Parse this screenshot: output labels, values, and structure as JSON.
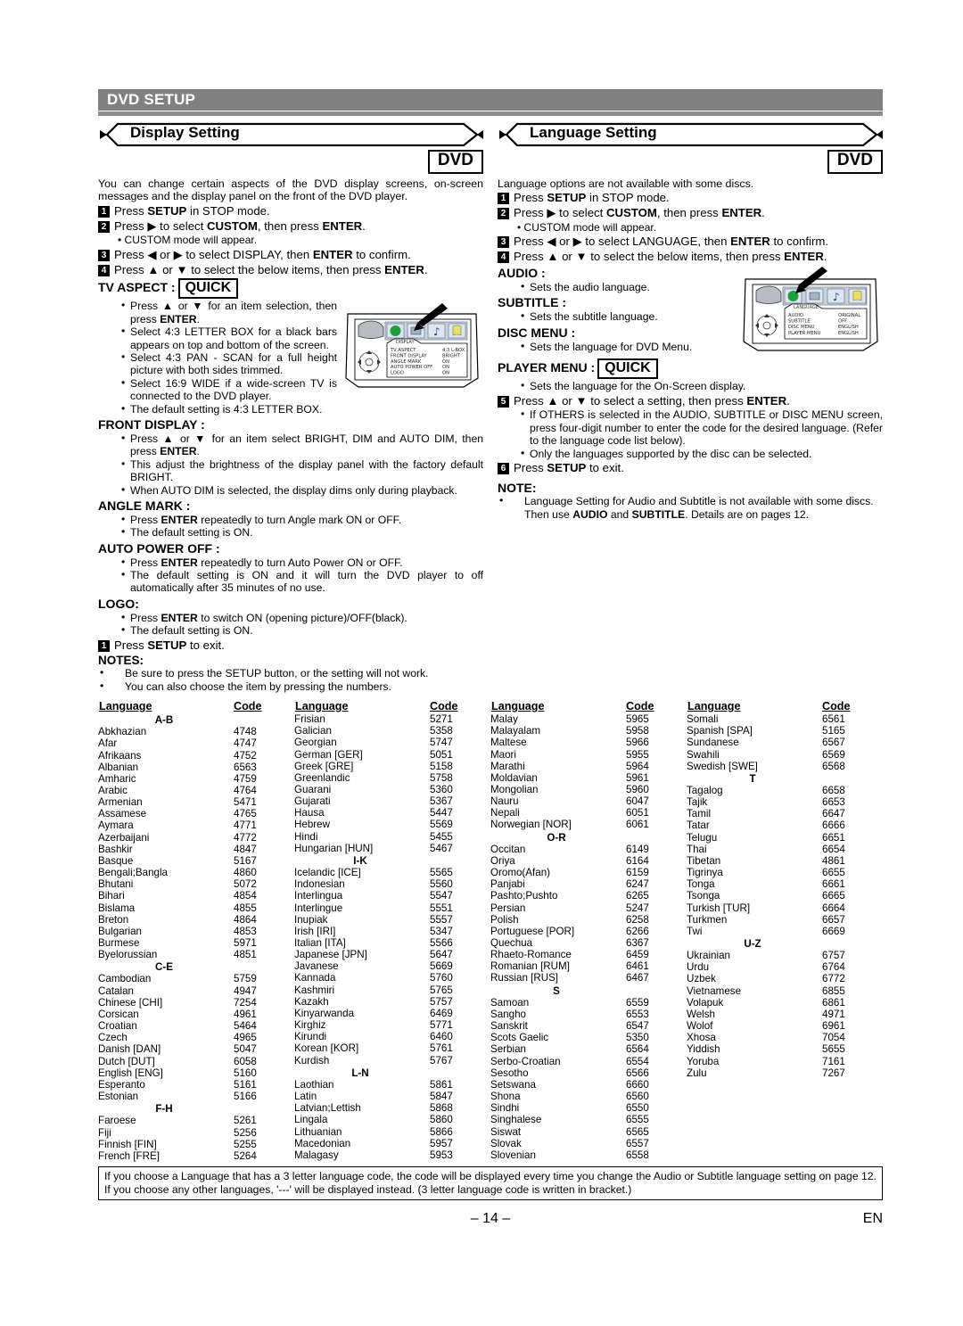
{
  "header": {
    "title": "DVD SETUP"
  },
  "left": {
    "ribbon_title": "Display Setting",
    "disc_badge": "DVD",
    "intro": "You can change certain aspects of the DVD display screens, on-screen messages and the display panel on the front of the DVD player.",
    "steps": [
      {
        "n": "1",
        "text_html": "Press <b>SETUP</b> in STOP mode."
      },
      {
        "n": "2",
        "text_html": "Press ▶ to select <b>CUSTOM</b>, then press <b>ENTER</b>."
      },
      {
        "n": "3",
        "text_html": "Press ◀ or ▶ to select DISPLAY, then <b>ENTER</b> to confirm."
      },
      {
        "n": "4",
        "text_html": "Press ▲ or ▼ to select the below items, then press <b>ENTER</b>."
      }
    ],
    "step2_sub": "CUSTOM mode will appear.",
    "tv_aspect": {
      "label": "TV ASPECT :",
      "quick": "QUICK",
      "bullets_html": [
        "Press ▲ or ▼ for an item selection, then press <b>ENTER</b>.",
        "Select 4:3 LETTER BOX for a black bars appears on top and bottom of the screen.",
        "Select 4:3 PAN - SCAN for a full height picture with both sides trimmed.",
        "Select 16:9 WIDE if a wide-screen TV is connected to the DVD player.",
        "The default setting is 4:3 LETTER BOX."
      ]
    },
    "front_display": {
      "label": "FRONT DISPLAY :",
      "bullets_html": [
        "Press ▲ or ▼ for an item select BRIGHT, DIM and AUTO DIM, then press <b>ENTER</b>.",
        "This adjust the brightness of the display panel with the factory default BRIGHT.",
        "When AUTO DIM is selected, the display dims only during playback."
      ]
    },
    "angle_mark": {
      "label": "ANGLE MARK :",
      "bullets_html": [
        "Press <b>ENTER</b> repeatedly to turn Angle mark ON or OFF.",
        "The default setting is ON."
      ]
    },
    "auto_power_off": {
      "label": "AUTO POWER OFF :",
      "bullets_html": [
        "Press <b>ENTER</b> repeatedly to turn Auto Power ON or OFF.",
        "The default setting is ON and it will turn the DVD player to off automatically after 35 minutes of no use."
      ]
    },
    "logo": {
      "label": "LOGO:",
      "bullets_html": [
        "Press <b>ENTER</b> to switch ON (opening picture)/OFF(black).",
        "The default setting is ON."
      ]
    },
    "exit_step": {
      "n": "1",
      "text_html": "Press <b>SETUP</b> to exit."
    },
    "notes_label": "NOTES:",
    "notes": [
      "Be sure to press the SETUP button, or the setting will not work.",
      "You can also choose the item by pressing the numbers."
    ],
    "osd": {
      "title": "DISPLAY",
      "rows": [
        {
          "name": "TV ASPECT",
          "value": "4:3 L-BOX"
        },
        {
          "name": "FRONT DISPLAY",
          "value": "BRIGHT"
        },
        {
          "name": "ANGLE MARK",
          "value": "ON"
        },
        {
          "name": "AUTO POWER OFF",
          "value": "ON"
        },
        {
          "name": "LOGO",
          "value": "ON"
        }
      ]
    }
  },
  "right": {
    "ribbon_title": "Language Setting",
    "disc_badge": "DVD",
    "intro": "Language options are not available with some discs.",
    "steps": [
      {
        "n": "1",
        "text_html": "Press <b>SETUP</b> in STOP mode."
      },
      {
        "n": "2",
        "text_html": "Press ▶ to select <b>CUSTOM</b>, then press <b>ENTER</b>."
      },
      {
        "n": "3",
        "text_html": "Press ◀ or ▶ to select LANGUAGE, then <b>ENTER</b> to confirm."
      },
      {
        "n": "4",
        "text_html": "Press ▲ or ▼ to select the below items, then press <b>ENTER</b>."
      }
    ],
    "step2_sub": "CUSTOM mode will appear.",
    "audio": {
      "label": "AUDIO :",
      "bullet": "Sets the audio language."
    },
    "subtitle": {
      "label": "SUBTITLE :",
      "bullet": "Sets the subtitle language."
    },
    "disc_menu": {
      "label": "DISC MENU :",
      "bullet": "Sets the language for DVD Menu."
    },
    "player_menu": {
      "label": "PLAYER MENU :",
      "quick": "QUICK",
      "bullet": "Sets the language for the On-Screen display."
    },
    "step5": {
      "n": "5",
      "text_html": "Press ▲ or ▼ to select a setting, then press <b>ENTER</b>."
    },
    "step5_bullets": [
      "If OTHERS is selected in the AUDIO, SUBTITLE or DISC MENU screen, press four-digit number to enter the code for the desired language. (Refer to the language code list below).",
      "Only the languages supported by the disc can be selected."
    ],
    "step6": {
      "n": "6",
      "text_html": "Press <b>SETUP</b> to exit."
    },
    "note_label": "NOTE:",
    "note_html": "Language Setting for Audio and Subtitle is not available with some discs. Then use <b>AUDIO</b> and <b>SUBTITLE</b>. Details are on pages 12.",
    "osd": {
      "title": "LANGUAGE",
      "rows": [
        {
          "name": "AUDIO",
          "value": "ORIGINAL"
        },
        {
          "name": "SUBTITLE",
          "value": "OFF"
        },
        {
          "name": "DISC MENU",
          "value": "ENGLISH"
        },
        {
          "name": "PLAYER MENU",
          "value": "ENGLISH"
        }
      ]
    }
  },
  "table": {
    "head_language": "Language",
    "head_code": "Code",
    "columns": [
      [
        {
          "group": "A-B"
        },
        {
          "lang": "Abkhazian",
          "code": "4748"
        },
        {
          "lang": "Afar",
          "code": "4747"
        },
        {
          "lang": "Afrikaans",
          "code": "4752"
        },
        {
          "lang": "Albanian",
          "code": "6563"
        },
        {
          "lang": "Amharic",
          "code": "4759"
        },
        {
          "lang": "Arabic",
          "code": "4764"
        },
        {
          "lang": "Armenian",
          "code": "5471"
        },
        {
          "lang": "Assamese",
          "code": "4765"
        },
        {
          "lang": "Aymara",
          "code": "4771"
        },
        {
          "lang": "Azerbaijani",
          "code": "4772"
        },
        {
          "lang": "Bashkir",
          "code": "4847"
        },
        {
          "lang": "Basque",
          "code": "5167"
        },
        {
          "lang": "Bengali;Bangla",
          "code": "4860"
        },
        {
          "lang": "Bhutani",
          "code": "5072"
        },
        {
          "lang": "Bihari",
          "code": "4854"
        },
        {
          "lang": "Bislama",
          "code": "4855"
        },
        {
          "lang": "Breton",
          "code": "4864"
        },
        {
          "lang": "Bulgarian",
          "code": "4853"
        },
        {
          "lang": "Burmese",
          "code": "5971"
        },
        {
          "lang": "Byelorussian",
          "code": "4851"
        },
        {
          "group": "C-E"
        },
        {
          "lang": "Cambodian",
          "code": "5759"
        },
        {
          "lang": "Catalan",
          "code": "4947"
        },
        {
          "lang": "Chinese [CHI]",
          "code": "7254"
        },
        {
          "lang": "Corsican",
          "code": "4961"
        },
        {
          "lang": "Croatian",
          "code": "5464"
        },
        {
          "lang": "Czech",
          "code": "4965"
        },
        {
          "lang": "Danish [DAN]",
          "code": "5047"
        },
        {
          "lang": "Dutch [DUT]",
          "code": "6058"
        },
        {
          "lang": "English [ENG]",
          "code": "5160"
        },
        {
          "lang": "Esperanto",
          "code": "5161"
        },
        {
          "lang": "Estonian",
          "code": "5166"
        },
        {
          "group": "F-H"
        },
        {
          "lang": "Faroese",
          "code": "5261"
        },
        {
          "lang": "Fiji",
          "code": "5256"
        },
        {
          "lang": "Finnish [FIN]",
          "code": "5255"
        },
        {
          "lang": "French [FRE]",
          "code": "5264"
        }
      ],
      [
        {
          "lang": "Frisian",
          "code": "5271"
        },
        {
          "lang": "Galician",
          "code": "5358"
        },
        {
          "lang": "Georgian",
          "code": "5747"
        },
        {
          "lang": "German [GER]",
          "code": "5051"
        },
        {
          "lang": "Greek [GRE]",
          "code": "5158"
        },
        {
          "lang": "Greenlandic",
          "code": "5758"
        },
        {
          "lang": "Guarani",
          "code": "5360"
        },
        {
          "lang": "Gujarati",
          "code": "5367"
        },
        {
          "lang": "Hausa",
          "code": "5447"
        },
        {
          "lang": "Hebrew",
          "code": "5569"
        },
        {
          "lang": "Hindi",
          "code": "5455"
        },
        {
          "lang": "Hungarian [HUN]",
          "code": "5467"
        },
        {
          "group": "I-K"
        },
        {
          "lang": "Icelandic [ICE]",
          "code": "5565"
        },
        {
          "lang": "Indonesian",
          "code": "5560"
        },
        {
          "lang": "Interlingua",
          "code": "5547"
        },
        {
          "lang": "Interlingue",
          "code": "5551"
        },
        {
          "lang": "Inupiak",
          "code": "5557"
        },
        {
          "lang": "Irish [IRI]",
          "code": "5347"
        },
        {
          "lang": "Italian [ITA]",
          "code": "5566"
        },
        {
          "lang": "Japanese [JPN]",
          "code": "5647"
        },
        {
          "lang": "Javanese",
          "code": "5669"
        },
        {
          "lang": "Kannada",
          "code": "5760"
        },
        {
          "lang": "Kashmiri",
          "code": "5765"
        },
        {
          "lang": "Kazakh",
          "code": "5757"
        },
        {
          "lang": "Kinyarwanda",
          "code": "6469"
        },
        {
          "lang": "Kirghiz",
          "code": "5771"
        },
        {
          "lang": "Kirundi",
          "code": "6460"
        },
        {
          "lang": "Korean [KOR]",
          "code": "5761"
        },
        {
          "lang": "Kurdish",
          "code": "5767"
        },
        {
          "group": "L-N"
        },
        {
          "lang": "Laothian",
          "code": "5861"
        },
        {
          "lang": "Latin",
          "code": "5847"
        },
        {
          "lang": "Latvian;Lettish",
          "code": "5868"
        },
        {
          "lang": "Lingala",
          "code": "5860"
        },
        {
          "lang": "Lithuanian",
          "code": "5866"
        },
        {
          "lang": "Macedonian",
          "code": "5957"
        },
        {
          "lang": "Malagasy",
          "code": "5953"
        }
      ],
      [
        {
          "lang": "Malay",
          "code": "5965"
        },
        {
          "lang": "Malayalam",
          "code": "5958"
        },
        {
          "lang": "Maltese",
          "code": "5966"
        },
        {
          "lang": "Maori",
          "code": "5955"
        },
        {
          "lang": "Marathi",
          "code": "5964"
        },
        {
          "lang": "Moldavian",
          "code": "5961"
        },
        {
          "lang": "Mongolian",
          "code": "5960"
        },
        {
          "lang": "Nauru",
          "code": "6047"
        },
        {
          "lang": "Nepali",
          "code": "6051"
        },
        {
          "lang": "Norwegian [NOR]",
          "code": "6061"
        },
        {
          "group": "O-R"
        },
        {
          "lang": "Occitan",
          "code": "6149"
        },
        {
          "lang": "Oriya",
          "code": "6164"
        },
        {
          "lang": "Oromo(Afan)",
          "code": "6159"
        },
        {
          "lang": "Panjabi",
          "code": "6247"
        },
        {
          "lang": "Pashto;Pushto",
          "code": "6265"
        },
        {
          "lang": "Persian",
          "code": "5247"
        },
        {
          "lang": "Polish",
          "code": "6258"
        },
        {
          "lang": "Portuguese [POR]",
          "code": "6266"
        },
        {
          "lang": "Quechua",
          "code": "6367"
        },
        {
          "lang": "Rhaeto-Romance",
          "code": "6459"
        },
        {
          "lang": "Romanian [RUM]",
          "code": "6461"
        },
        {
          "lang": "Russian [RUS]",
          "code": "6467"
        },
        {
          "group": "S"
        },
        {
          "lang": "Samoan",
          "code": "6559"
        },
        {
          "lang": "Sangho",
          "code": "6553"
        },
        {
          "lang": "Sanskrit",
          "code": "6547"
        },
        {
          "lang": "Scots Gaelic",
          "code": "5350"
        },
        {
          "lang": "Serbian",
          "code": "6564"
        },
        {
          "lang": "Serbo-Croatian",
          "code": "6554"
        },
        {
          "lang": "Sesotho",
          "code": "6566"
        },
        {
          "lang": "Setswana",
          "code": "6660"
        },
        {
          "lang": "Shona",
          "code": "6560"
        },
        {
          "lang": "Sindhi",
          "code": "6550"
        },
        {
          "lang": "Singhalese",
          "code": "6555"
        },
        {
          "lang": "Siswat",
          "code": "6565"
        },
        {
          "lang": "Slovak",
          "code": "6557"
        },
        {
          "lang": "Slovenian",
          "code": "6558"
        }
      ],
      [
        {
          "lang": "Somali",
          "code": "6561"
        },
        {
          "lang": "Spanish [SPA]",
          "code": "5165"
        },
        {
          "lang": "Sundanese",
          "code": "6567"
        },
        {
          "lang": "Swahili",
          "code": "6569"
        },
        {
          "lang": "Swedish [SWE]",
          "code": "6568"
        },
        {
          "group": "T"
        },
        {
          "lang": "Tagalog",
          "code": "6658"
        },
        {
          "lang": "Tajik",
          "code": "6653"
        },
        {
          "lang": "Tamil",
          "code": "6647"
        },
        {
          "lang": "Tatar",
          "code": "6666"
        },
        {
          "lang": "Telugu",
          "code": "6651"
        },
        {
          "lang": "Thai",
          "code": "6654"
        },
        {
          "lang": "Tibetan",
          "code": "4861"
        },
        {
          "lang": "Tigrinya",
          "code": "6655"
        },
        {
          "lang": "Tonga",
          "code": "6661"
        },
        {
          "lang": "Tsonga",
          "code": "6665"
        },
        {
          "lang": "Turkish [TUR]",
          "code": "6664"
        },
        {
          "lang": "Turkmen",
          "code": "6657"
        },
        {
          "lang": "Twi",
          "code": "6669"
        },
        {
          "group": "U-Z"
        },
        {
          "lang": "Ukrainian",
          "code": "6757"
        },
        {
          "lang": "Urdu",
          "code": "6764"
        },
        {
          "lang": "Uzbek",
          "code": "6772"
        },
        {
          "lang": "Vietnamese",
          "code": "6855"
        },
        {
          "lang": "Volapuk",
          "code": "6861"
        },
        {
          "lang": "Welsh",
          "code": "4971"
        },
        {
          "lang": "Wolof",
          "code": "6961"
        },
        {
          "lang": "Xhosa",
          "code": "7054"
        },
        {
          "lang": "Yiddish",
          "code": "5655"
        },
        {
          "lang": "Yoruba",
          "code": "7161"
        },
        {
          "lang": "Zulu",
          "code": "7267"
        }
      ]
    ]
  },
  "footer": {
    "note": "If you choose a Language that has a 3 letter language code, the code will be displayed every time you change the Audio or Subtitle language setting on page 12. If you choose any other languages, '---' will be displayed instead. (3 letter language code is written in bracket.)",
    "page_number": "– 14 –",
    "region": "EN"
  }
}
